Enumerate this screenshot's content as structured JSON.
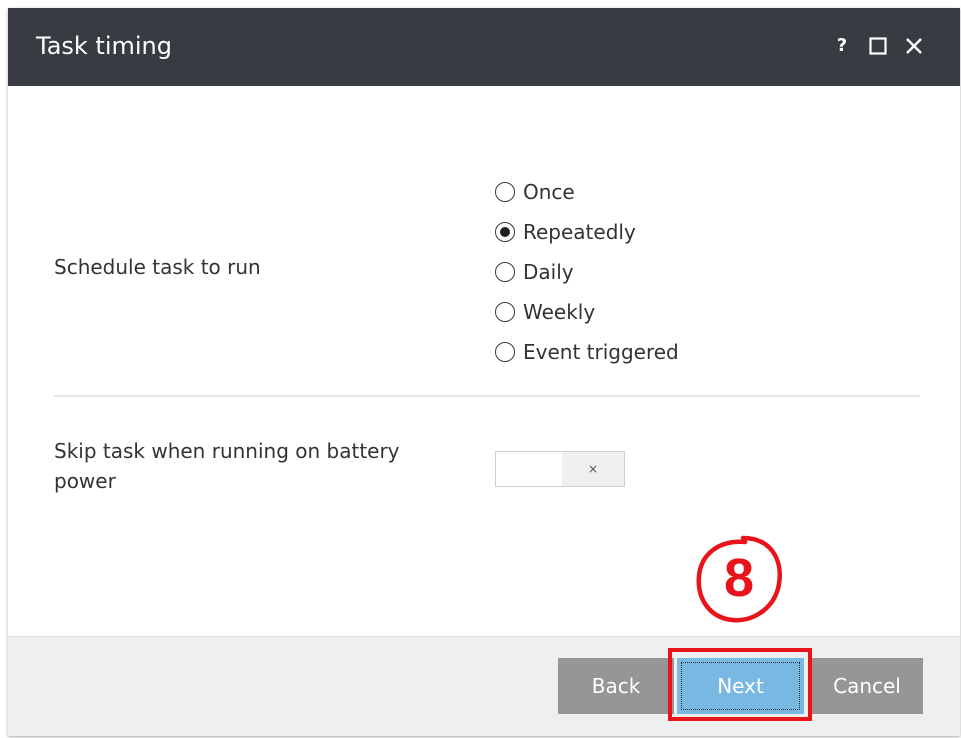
{
  "dialog": {
    "title": "Task timing",
    "controls": {
      "help": "?",
      "maximize_icon": "maximize-icon",
      "close_icon": "close-icon"
    }
  },
  "schedule": {
    "label": "Schedule task to run",
    "options": [
      {
        "label": "Once",
        "checked": false
      },
      {
        "label": "Repeatedly",
        "checked": true
      },
      {
        "label": "Daily",
        "checked": false
      },
      {
        "label": "Weekly",
        "checked": false
      },
      {
        "label": "Event triggered",
        "checked": false
      }
    ]
  },
  "battery": {
    "label": "Skip task when running on battery power",
    "toggle_state": "×"
  },
  "footer": {
    "back_label": "Back",
    "next_label": "Next",
    "cancel_label": "Cancel"
  },
  "annotation": {
    "step_number": "8",
    "color": "#e8141b"
  },
  "colors": {
    "titlebar": "#383c42",
    "primary_button": "#79b8e3",
    "secondary_button": "#969696"
  }
}
